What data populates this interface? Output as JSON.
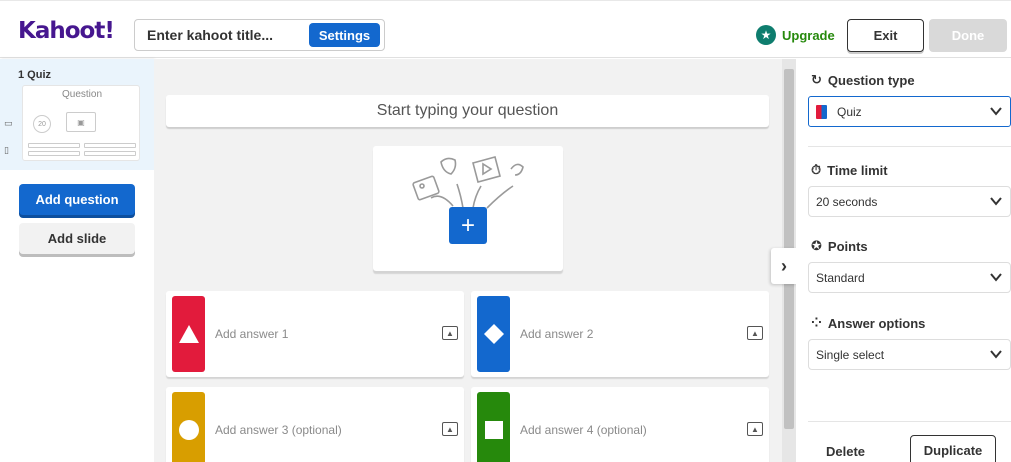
{
  "header": {
    "logo": "Kahoot!",
    "title_placeholder": "Enter kahoot title...",
    "settings_label": "Settings",
    "upgrade_label": "Upgrade",
    "exit_label": "Exit",
    "done_label": "Done"
  },
  "sidebar": {
    "slide_label": "1  Quiz",
    "thumb_title": "Question",
    "thumb_timer": "20",
    "add_question_label": "Add question",
    "add_slide_label": "Add slide"
  },
  "editor": {
    "question_placeholder": "Start typing your question",
    "answers": [
      {
        "label": "Add answer 1",
        "color": "#e21b3c",
        "shape": "triangle"
      },
      {
        "label": "Add answer 2",
        "color": "#1368ce",
        "shape": "diamond"
      },
      {
        "label": "Add answer 3 (optional)",
        "color": "#d89e00",
        "shape": "circle"
      },
      {
        "label": "Add answer 4 (optional)",
        "color": "#26890c",
        "shape": "square"
      }
    ]
  },
  "settings_panel": {
    "question_type_label": "Question type",
    "question_type_value": "Quiz",
    "time_limit_label": "Time limit",
    "time_limit_value": "20 seconds",
    "points_label": "Points",
    "points_value": "Standard",
    "answer_options_label": "Answer options",
    "answer_options_value": "Single select",
    "delete_label": "Delete",
    "duplicate_label": "Duplicate"
  }
}
